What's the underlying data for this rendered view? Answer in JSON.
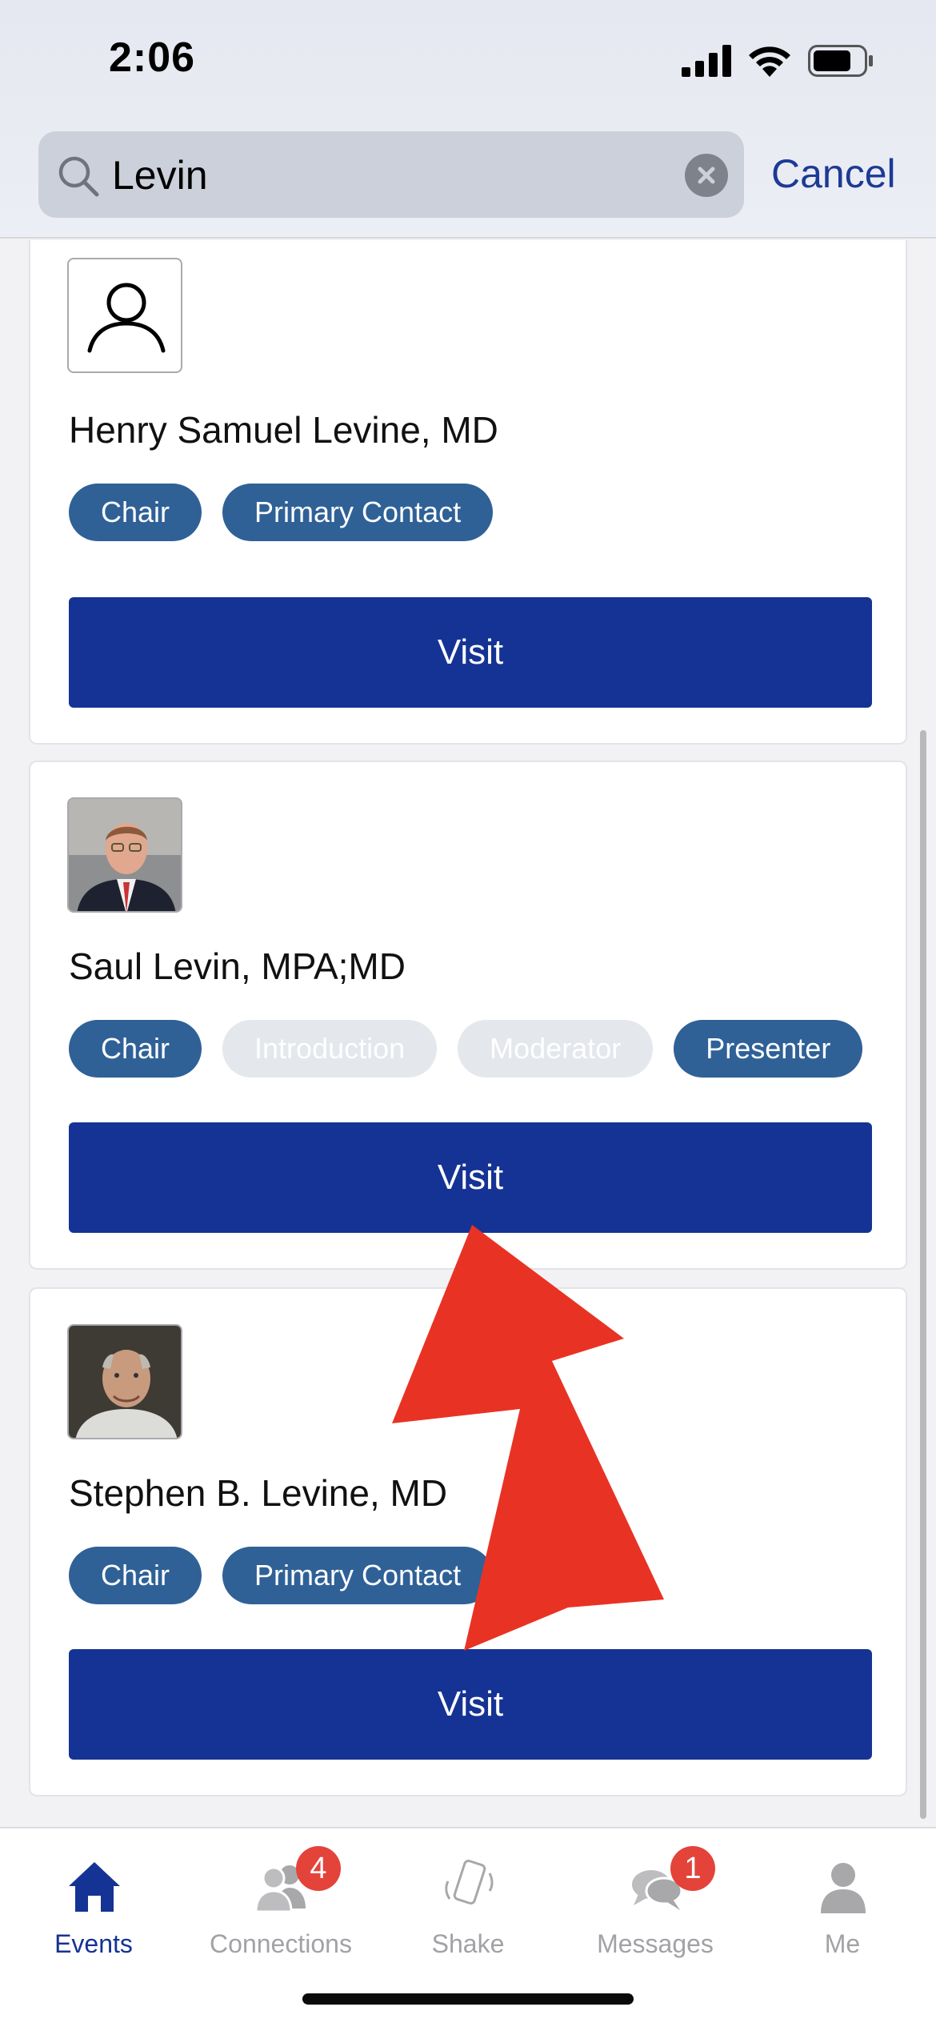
{
  "status_bar": {
    "time": "2:06"
  },
  "search": {
    "value": "Levin",
    "cancel_label": "Cancel"
  },
  "results": [
    {
      "name": "Henry Samuel Levine, MD",
      "avatar": "person-placeholder-icon",
      "tags": [
        {
          "label": "Chair",
          "active": true
        },
        {
          "label": "Primary Contact",
          "active": true
        }
      ],
      "visit_label": "Visit"
    },
    {
      "name": "Saul Levin, MPA;MD",
      "avatar": "photo",
      "tags": [
        {
          "label": "Chair",
          "active": true
        },
        {
          "label": "Introduction",
          "active": false
        },
        {
          "label": "Moderator",
          "active": false
        },
        {
          "label": "Presenter",
          "active": true
        }
      ],
      "visit_label": "Visit"
    },
    {
      "name": "Stephen B. Levine, MD",
      "avatar": "photo",
      "tags": [
        {
          "label": "Chair",
          "active": true
        },
        {
          "label": "Primary Contact",
          "active": true
        }
      ],
      "visit_label": "Visit"
    }
  ],
  "tabbar": {
    "tabs": [
      {
        "label": "Events",
        "icon": "home-icon",
        "active": true
      },
      {
        "label": "Connections",
        "icon": "people-icon",
        "badge": "4"
      },
      {
        "label": "Shake",
        "icon": "phone-shake-icon"
      },
      {
        "label": "Messages",
        "icon": "chat-bubbles-icon",
        "badge": "1"
      },
      {
        "label": "Me",
        "icon": "person-icon"
      }
    ]
  },
  "colors": {
    "primary": "#153394",
    "tag_active": "#2f6197",
    "tag_inactive": "#e4e7ec",
    "badge": "#e4433a",
    "annotation_arrow": "#e83324"
  }
}
